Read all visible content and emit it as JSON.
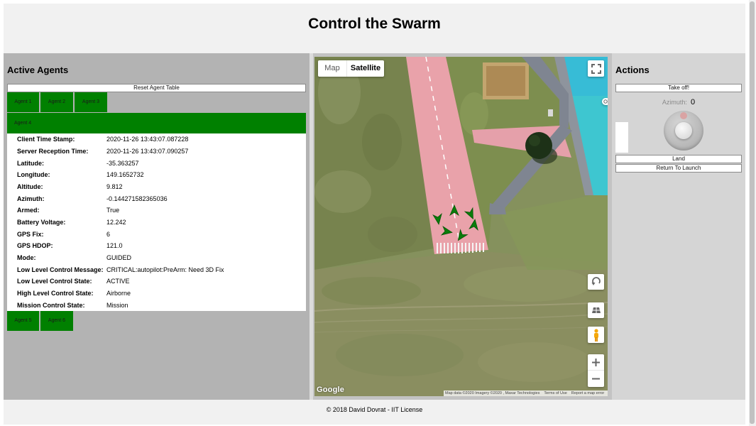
{
  "header": {
    "title": "Control the Swarm"
  },
  "agents_panel": {
    "heading": "Active Agents",
    "reset_button": "Reset Agent Table",
    "tabs": [
      "Agent 1",
      "Agent 2",
      "Agent 3",
      "Agent 4",
      "Agent 5",
      "Agent 6"
    ],
    "selected_tab_index": 3,
    "details": [
      {
        "label": "Client Time Stamp:",
        "value": "2020-11-26 13:43:07.087228"
      },
      {
        "label": "Server Reception Time:",
        "value": "2020-11-26 13:43:07.090257"
      },
      {
        "label": "Latitude:",
        "value": "-35.363257"
      },
      {
        "label": "Longitude:",
        "value": "149.1652732"
      },
      {
        "label": "Altitude:",
        "value": "9.812"
      },
      {
        "label": "Azimuth:",
        "value": "-0.144271582365036"
      },
      {
        "label": "Armed:",
        "value": "True"
      },
      {
        "label": "Battery Voltage:",
        "value": "12.242"
      },
      {
        "label": "GPS Fix:",
        "value": "6"
      },
      {
        "label": "GPS HDOP:",
        "value": "121.0"
      },
      {
        "label": "Mode:",
        "value": "GUIDED"
      },
      {
        "label": "Low Level Control Message:",
        "value": "CRITICAL:autopilot:PreArm: Need 3D Fix"
      },
      {
        "label": "Low Level Control State:",
        "value": "ACTIVE"
      },
      {
        "label": "High Level Control State:",
        "value": "Airborne"
      },
      {
        "label": "Mission Control State:",
        "value": "Mission"
      }
    ]
  },
  "map": {
    "type_control": {
      "options": [
        "Map",
        "Satellite"
      ],
      "selected_index": 1
    },
    "logo": "Google",
    "attribution": {
      "data": "Map data ©2020 Imagery ©2020 , Maxar Technologies",
      "terms": "Terms of Use",
      "report": "Report a map error"
    },
    "icons": {
      "fullscreen": "fullscreen-icon",
      "camera": "camera-icon",
      "rotate": "rotate-map-icon",
      "tilt": "tilt-icon",
      "pegman": "pegman-icon",
      "zoom_in": "zoom-in-icon",
      "zoom_out": "zoom-out-icon",
      "agent_marker": "drone-marker-icon"
    }
  },
  "actions_panel": {
    "heading": "Actions",
    "takeoff_button": "Take off!",
    "azimuth_label": "Azimuth:",
    "azimuth_value": "0",
    "land_button": "Land",
    "rtl_button": "Return To Launch",
    "icons": {
      "knob": "azimuth-knob-icon"
    }
  },
  "footer": {
    "text": "© 2018 David Dovrat - IIT License"
  },
  "colors": {
    "header_bg": "#f1f1f1",
    "panel_left": "#b3b3b3",
    "panel_right": "#d5d5d5",
    "tab_green": "#008000",
    "marker_green": "#0b7d0b",
    "runway_pink": "#e9a2aa",
    "water_cyan": "#3ec6d0"
  }
}
